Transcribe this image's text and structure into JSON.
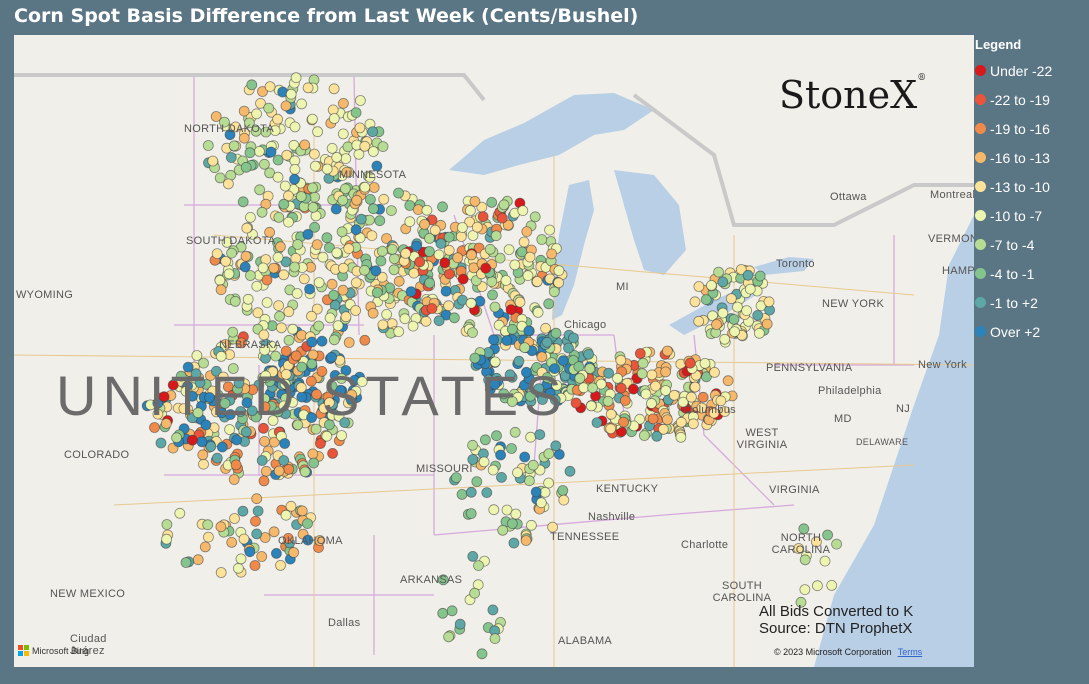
{
  "title": "Corn Spot Basis Difference from Last Week (Cents/Bushel)",
  "legend": {
    "title": "Legend",
    "items": [
      {
        "label": "Under -22",
        "color": "#d7191c"
      },
      {
        "label": "-22 to -19",
        "color": "#e8553a"
      },
      {
        "label": "-19 to -16",
        "color": "#f08a4b"
      },
      {
        "label": "-16 to -13",
        "color": "#f6b96b"
      },
      {
        "label": "-13 to -10",
        "color": "#fde39a"
      },
      {
        "label": "-10 to -7",
        "color": "#eef5b0"
      },
      {
        "label": "-7 to -4",
        "color": "#b7dc93"
      },
      {
        "label": "-4 to -1",
        "color": "#86c48d"
      },
      {
        "label": "-1 to +2",
        "color": "#5ea7a7"
      },
      {
        "label": "Over +2",
        "color": "#2b83ba"
      }
    ]
  },
  "logo": "StoneX",
  "note": {
    "line1": "All Bids Converted to K",
    "line2": "Source: DTN ProphetX"
  },
  "attribution": {
    "bing": "Microsoft Bing",
    "copyright": "© 2023 Microsoft Corporation",
    "terms": "Terms"
  },
  "places": [
    "NORTH DAKOTA",
    "MINNESOTA",
    "SOUTH DAKOTA",
    "WYOMING",
    "NEBRASKA",
    "COLORADO",
    "MISSOURI",
    "OKLAHOMA",
    "ARKANSAS",
    "NEW MEXICO",
    "TENNESSEE",
    "KENTUCKY",
    "WEST VIRGINIA",
    "VIRGINIA",
    "NORTH CAROLINA",
    "SOUTH CAROLINA",
    "PENNSYLVANIA",
    "NEW YORK",
    "VERMONT",
    "Ottawa",
    "Montreal",
    "Toronto",
    "Chicago",
    "Columbus",
    "Nashville",
    "Charlotte",
    "Philadelphia",
    "New York",
    "Dallas",
    "ALABAMA",
    "DELAWARE",
    "MD",
    "NJ",
    "HAMP",
    "MI",
    "Ciudad Juárez",
    "UNITED STATES"
  ]
}
